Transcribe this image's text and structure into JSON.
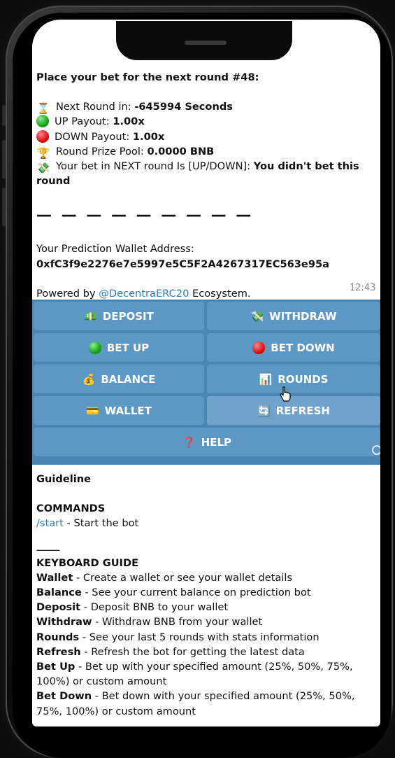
{
  "bet_message": {
    "heading": "Place your bet for the next round #48:",
    "next_round_label": "Next Round in: ",
    "next_round_value": "-645994 Seconds",
    "up_payout_label": "UP Payout: ",
    "up_payout_value": "1.00x",
    "down_payout_label": "DOWN Payout: ",
    "down_payout_value": "1.00x",
    "prize_pool_label": "Round Prize Pool: ",
    "prize_pool_value": "0.0000 BNB",
    "your_bet_label": "Your bet in NEXT round Is [UP/DOWN]: ",
    "your_bet_value": "You didn't bet this round",
    "separator": "— — — — — — — — —",
    "wallet_label": "Your Prediction Wallet Address:",
    "wallet_address": "0xfC3f9e2276e7e5997e5C5F2A4267317EC563e95a",
    "powered_prefix": "Powered by ",
    "powered_link": "@DecentraERC20",
    "powered_suffix": " Ecosystem.",
    "time": "12:43"
  },
  "keyboard": {
    "deposit": "DEPOSIT",
    "withdraw": "WITHDRAW",
    "bet_up": "BET UP",
    "bet_down": "BET DOWN",
    "balance": "BALANCE",
    "rounds": "ROUNDS",
    "wallet": "WALLET",
    "refresh": "REFRESH",
    "help": "HELP"
  },
  "guideline": {
    "title": "Guideline",
    "commands_title": "COMMANDS",
    "start_cmd": "/start",
    "start_desc": " - Start the bot",
    "divider": "------------",
    "keyboard_title": "KEYBOARD GUIDE",
    "items": [
      {
        "name": "Wallet",
        "desc": " - Create a wallet or see your wallet details"
      },
      {
        "name": "Balance",
        "desc": " - See your current balance on prediction bot"
      },
      {
        "name": "Deposit",
        "desc": " - Deposit BNB to your wallet"
      },
      {
        "name": "Withdraw",
        "desc": " - Withdraw BNB from your wallet"
      },
      {
        "name": "Rounds",
        "desc": " - See your last 5 rounds with stats information"
      },
      {
        "name": "Refresh",
        "desc": " - Refresh the bot for getting the latest data"
      },
      {
        "name": "Bet Up",
        "desc": " - Bet up with your specified amount (25%, 50%, 75%, 100%) or custom amount"
      },
      {
        "name": "Bet Down",
        "desc": " - Bet down with your specified amount (25%, 50%, 75%, 100%) or custom amount"
      }
    ]
  },
  "colors": {
    "keyboard_bg": "#4a86b4",
    "button_bg": "#5d97c3",
    "link": "#2f7fb5"
  }
}
